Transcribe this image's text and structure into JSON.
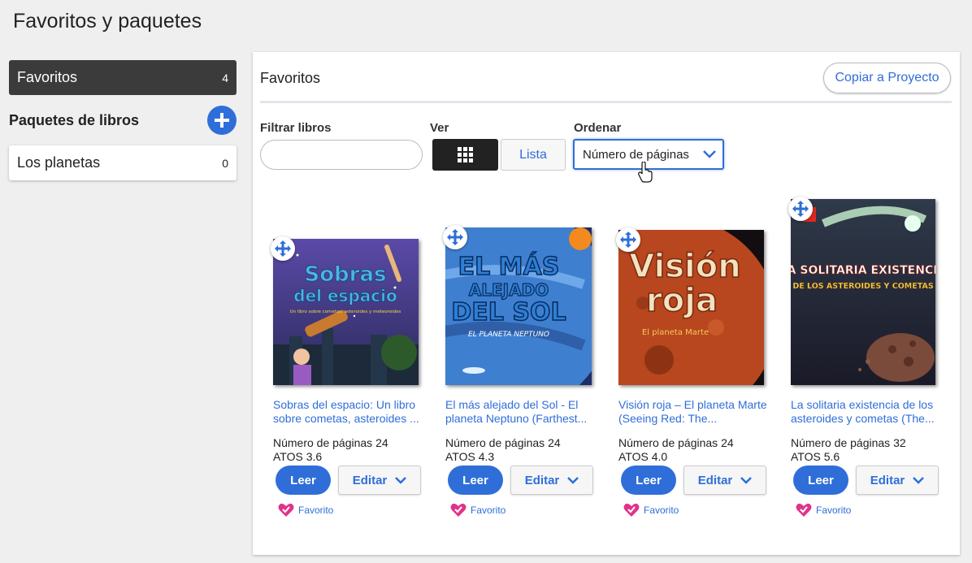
{
  "page_title": "Favoritos y paquetes",
  "sidebar": {
    "favorites": {
      "label": "Favoritos",
      "count": "4"
    },
    "packages_title": "Paquetes de libros",
    "add_icon": "plus-circle-icon",
    "packages": [
      {
        "label": "Los planetas",
        "count": "0"
      }
    ]
  },
  "main": {
    "title": "Favoritos",
    "copy_button": "Copiar a Proyecto",
    "filter_label": "Filtrar libros",
    "filter_value": "",
    "view_label": "Ver",
    "view_grid_icon": "grid-icon",
    "view_list_label": "Lista",
    "sort_label": "Ordenar",
    "sort_value": "Número de páginas",
    "pages_label": "Número de páginas",
    "atos_label": "ATOS",
    "read_label": "Leer",
    "edit_label": "Editar",
    "favorite_label": "Favorito"
  },
  "books": [
    {
      "title": "Sobras del espacio: Un libro sobre cometas, asteroides ...",
      "cover_title_1": "Sobras",
      "cover_title_2": "del espacio",
      "cover_subtitle": "Un libro sobre cometas, asteroides y meteoroides",
      "pages": "24",
      "atos": "3.6"
    },
    {
      "title": "El más alejado del Sol - El planeta Neptuno (Farthest...",
      "cover_title_1": "EL MÁS",
      "cover_title_2": "ALEJADO",
      "cover_title_3": "DEL SOL",
      "cover_subtitle": "EL PLANETA NEPTUNO",
      "pages": "24",
      "atos": "4.3"
    },
    {
      "title": "Visión roja – El planeta Marte (Seeing Red: The...",
      "cover_title_1": "Visión",
      "cover_title_2": "roja",
      "cover_subtitle": "El planeta Marte",
      "pages": "24",
      "atos": "4.0"
    },
    {
      "title": "La solitaria existencia de los asteroides y cometas (The...",
      "cover_title_1": "LA SOLITARIA EXISTENCIA",
      "cover_title_2": "DE LOS ASTEROIDES Y COMETAS",
      "pages": "32",
      "atos": "5.6"
    }
  ],
  "colors": {
    "accent": "#2f6ed9",
    "dark": "#3b3b3b",
    "heart": "#e0338a"
  }
}
